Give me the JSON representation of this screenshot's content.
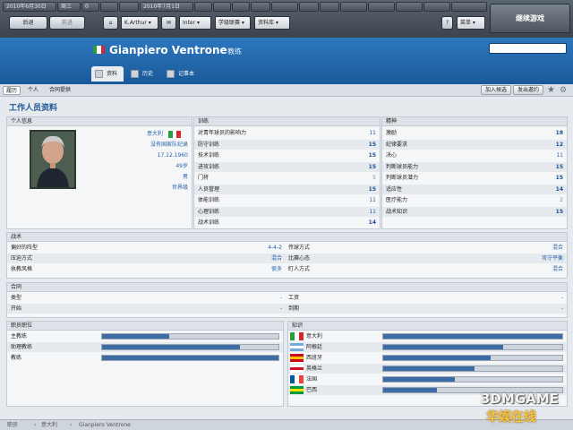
{
  "topbar": {
    "date_cell": "2010年6月30日",
    "week_cell": "周三",
    "score_cell": "0",
    "date_cell2": "2010年7月1日",
    "continue_label": "继续游戏",
    "back_label": "后退",
    "forward_label": "前进",
    "manager_dropdown": "K.Arthur",
    "club_dropdown": "Inter",
    "world_dropdown": "学级联赛",
    "search_dropdown": "资料库",
    "help_label": "?",
    "options_dropdown": "菜单"
  },
  "header": {
    "name": "Gianpiero Ventrone",
    "role": "教练",
    "flag_colors": [
      "#2a9d3e",
      "#ffffff",
      "#d6262e"
    ],
    "tabs": [
      {
        "label": "资料",
        "active": true
      },
      {
        "label": "历史",
        "active": false
      },
      {
        "label": "记事本",
        "active": false
      }
    ]
  },
  "subbar": {
    "tabs": [
      {
        "label": "履历",
        "active": true
      },
      {
        "label": "个人",
        "active": false
      },
      {
        "label": "合同提供",
        "active": false
      }
    ],
    "btn_shortlist": "加入候选",
    "btn_offer": "发出邀约"
  },
  "page_title": "工作人员资料",
  "personal": {
    "title": "个人信息",
    "values": [
      "意大利",
      "没有国家队纪录",
      "17.12.1960",
      "49岁",
      "男",
      "世界级"
    ]
  },
  "training": {
    "title": "训练",
    "rows": [
      {
        "label": "对青年球员的影响力",
        "value": "11"
      },
      {
        "label": "防守训练",
        "value": "15"
      },
      {
        "label": "技术训练",
        "value": "15"
      },
      {
        "label": "进攻训练",
        "value": "15"
      },
      {
        "label": "门将",
        "value": "5"
      },
      {
        "label": "人员管理",
        "value": "15"
      },
      {
        "label": "体能训练",
        "value": "11"
      },
      {
        "label": "心理训练",
        "value": "11"
      },
      {
        "label": "战术训练",
        "value": "14"
      }
    ]
  },
  "mental": {
    "title": "精神",
    "rows": [
      {
        "label": "激励",
        "value": "18"
      },
      {
        "label": "纪律要求",
        "value": "12"
      },
      {
        "label": "决心",
        "value": "11"
      },
      {
        "label": "判断球员能力",
        "value": "15"
      },
      {
        "label": "判断球员潜力",
        "value": "15"
      },
      {
        "label": "适应性",
        "value": "14"
      },
      {
        "label": "医疗能力",
        "value": "2"
      },
      {
        "label": "战术知识",
        "value": "15"
      }
    ]
  },
  "tactics": {
    "title": "战术",
    "rows": [
      {
        "l1": "偏好的阵型",
        "v1": "4-4-2",
        "l2": "传球方式",
        "v2": "混合"
      },
      {
        "l1": "压迫方式",
        "v1": "混合",
        "l2": "比赛心态",
        "v2": "攻守平衡"
      },
      {
        "l1": "执教风格",
        "v1": "很多",
        "l2": "盯人方式",
        "v2": "混合"
      }
    ]
  },
  "contract": {
    "title": "合同",
    "rows": [
      {
        "l1": "类型",
        "v1": "-",
        "l2": "工资",
        "v2": "-"
      },
      {
        "l1": "开始",
        "v1": "-",
        "l2": "到期",
        "v2": "-"
      }
    ]
  },
  "positions": {
    "title": "职员职位",
    "rows": [
      {
        "label": "主教练",
        "level": 0.38
      },
      {
        "label": "助理教练",
        "level": 0.78
      },
      {
        "label": "教练",
        "level": 1.0
      }
    ]
  },
  "languages": {
    "title": "知识",
    "rows": [
      {
        "label": "意大利",
        "level": 1.0
      },
      {
        "label": "阿根廷",
        "level": 0.67
      },
      {
        "label": "西班牙",
        "level": 0.6
      },
      {
        "label": "英格兰",
        "level": 0.51
      },
      {
        "label": "法国",
        "level": 0.4
      },
      {
        "label": "巴西",
        "level": 0.3
      }
    ]
  },
  "footer": {
    "crumb1": "职员",
    "crumb2": "意大利",
    "crumb3": "Gianpiero Ventrone"
  },
  "watermark": {
    "line1": "3DMGAME",
    "line2": "华娱在线"
  }
}
